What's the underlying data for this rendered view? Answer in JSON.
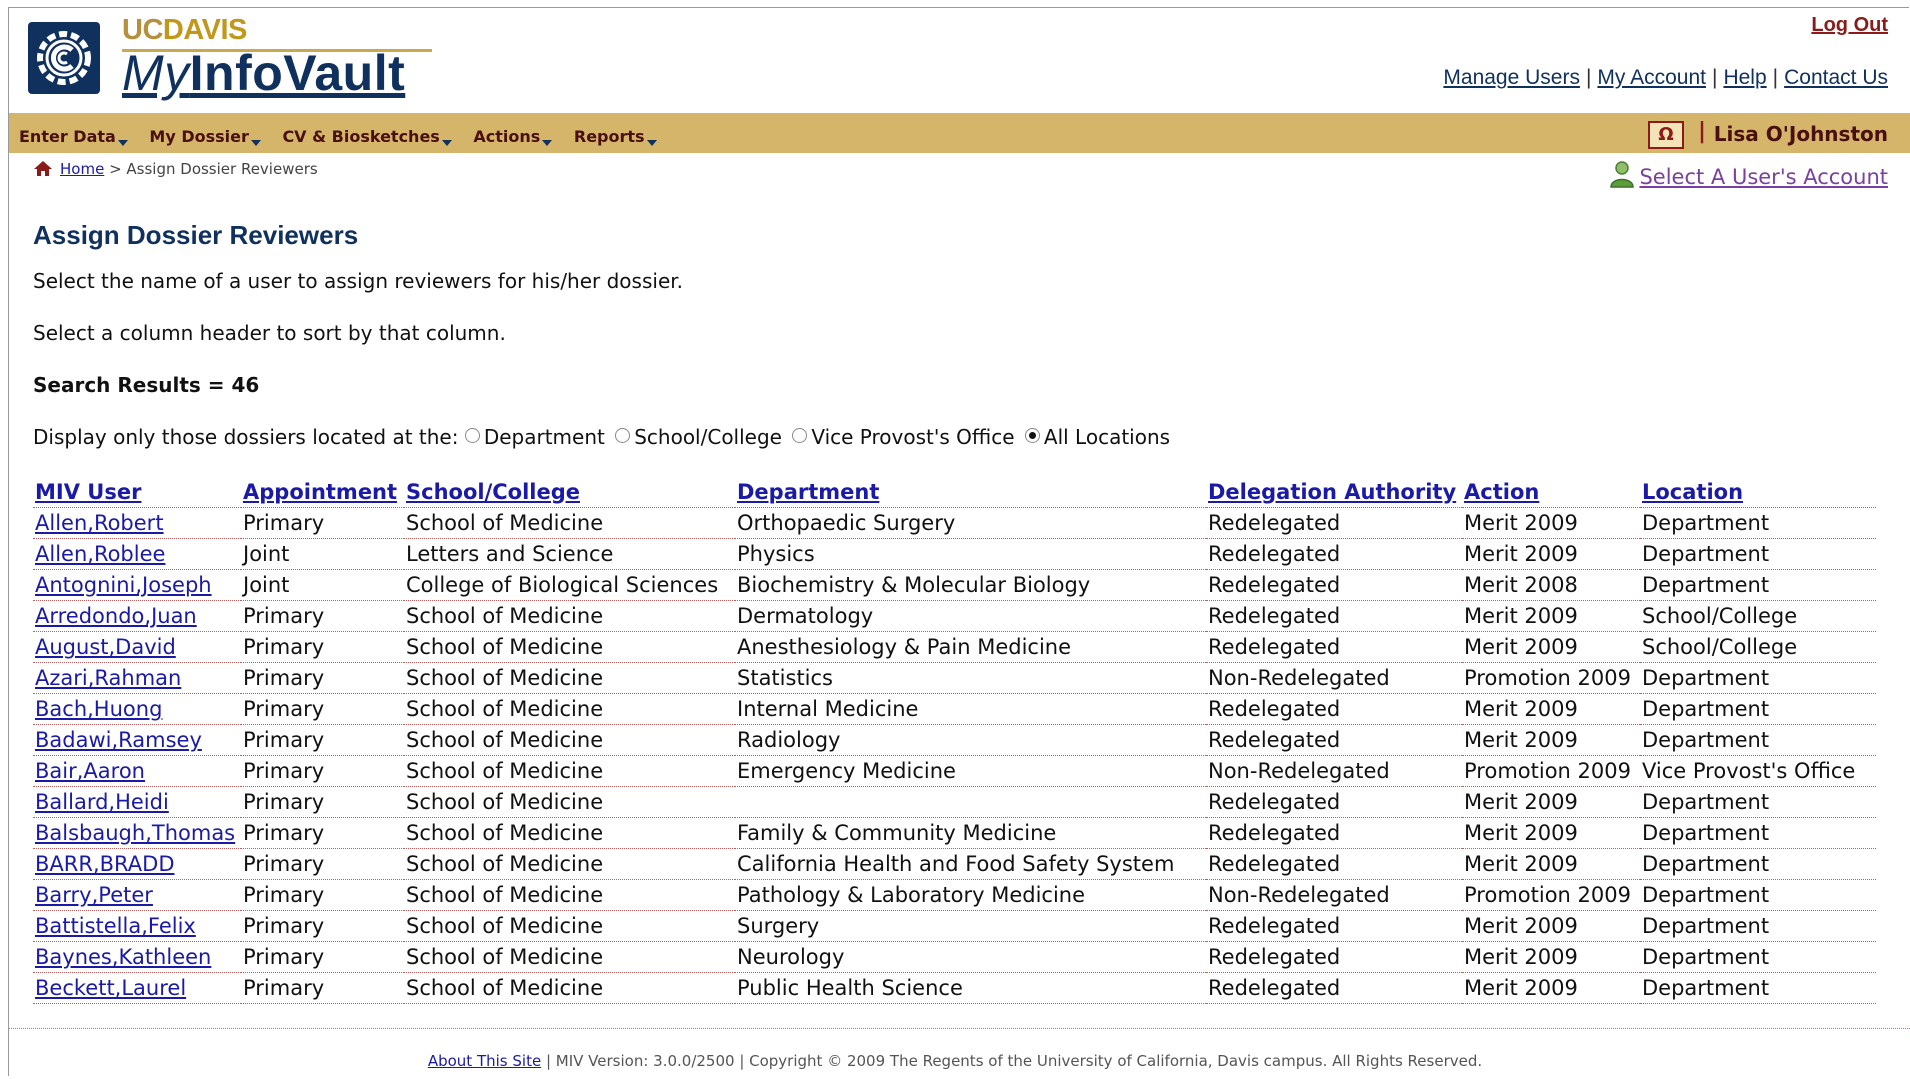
{
  "header": {
    "brand_uc": "UC",
    "brand_davis": "DAVIS",
    "brand_my": "My",
    "brand_infovault": "InfoVault",
    "logout": "Log Out",
    "links": [
      "Manage Users",
      "My Account",
      "Help",
      "Contact Us"
    ],
    "separator": "|"
  },
  "nav": {
    "items": [
      "Enter Data",
      "My Dossier",
      "CV & Biosketches",
      "Actions",
      "Reports"
    ],
    "omega": "Ω",
    "separator": "|",
    "user_name": "Lisa O'Johnston"
  },
  "breadcrumb": {
    "home": "Home",
    "current": "> Assign Dossier Reviewers"
  },
  "select_account": "Select A User's Account",
  "page": {
    "title": "Assign Dossier Reviewers",
    "instruction1": "Select the name of a user to assign reviewers for his/her dossier.",
    "instruction2": "Select a column header to sort by that column.",
    "results": "Search Results = 46",
    "filter_label": "Display only those dossiers located at the:",
    "filter_options": [
      "Department",
      "School/College",
      "Vice Provost's Office",
      "All Locations"
    ],
    "filter_selected": "All Locations"
  },
  "table": {
    "columns": [
      "MIV User",
      "Appointment",
      "School/College",
      "Department",
      "Delegation Authority",
      "Action",
      "Location"
    ],
    "rows": [
      [
        "Allen,Robert",
        "Primary",
        "School of Medicine",
        "Orthopaedic Surgery",
        "Redelegated",
        "Merit 2009",
        "Department"
      ],
      [
        "Allen,Roblee",
        "Joint",
        "Letters and Science",
        "Physics",
        "Redelegated",
        "Merit 2009",
        "Department"
      ],
      [
        "Antognini,Joseph",
        "Joint",
        "College of Biological Sciences",
        "Biochemistry & Molecular Biology",
        "Redelegated",
        "Merit 2008",
        "Department"
      ],
      [
        "Arredondo,Juan",
        "Primary",
        "School of Medicine",
        "Dermatology",
        "Redelegated",
        "Merit 2009",
        "School/College"
      ],
      [
        "August,David",
        "Primary",
        "School of Medicine",
        "Anesthesiology & Pain Medicine",
        "Redelegated",
        "Merit 2009",
        "School/College"
      ],
      [
        "Azari,Rahman",
        "Primary",
        "School of Medicine",
        "Statistics",
        "Non-Redelegated",
        "Promotion 2009",
        "Department"
      ],
      [
        "Bach,Huong",
        "Primary",
        "School of Medicine",
        "Internal Medicine",
        "Redelegated",
        "Merit 2009",
        "Department"
      ],
      [
        "Badawi,Ramsey",
        "Primary",
        "School of Medicine",
        "Radiology",
        "Redelegated",
        "Merit 2009",
        "Department"
      ],
      [
        "Bair,Aaron",
        "Primary",
        "School of Medicine",
        "Emergency Medicine",
        "Non-Redelegated",
        "Promotion 2009",
        "Vice Provost's Office"
      ],
      [
        "Ballard,Heidi",
        "Primary",
        "School of Medicine",
        "",
        "Redelegated",
        "Merit 2009",
        "Department"
      ],
      [
        "Balsbaugh,Thomas",
        "Primary",
        "School of Medicine",
        "Family & Community Medicine",
        "Redelegated",
        "Merit 2009",
        "Department"
      ],
      [
        "BARR,BRADD",
        "Primary",
        "School of Medicine",
        "California Health and Food Safety System",
        "Redelegated",
        "Merit 2009",
        "Department"
      ],
      [
        "Barry,Peter",
        "Primary",
        "School of Medicine",
        "Pathology & Laboratory Medicine",
        "Non-Redelegated",
        "Promotion 2009",
        "Department"
      ],
      [
        "Battistella,Felix",
        "Primary",
        "School of Medicine",
        "Surgery",
        "Redelegated",
        "Merit 2009",
        "Department"
      ],
      [
        "Baynes,Kathleen",
        "Primary",
        "School of Medicine",
        "Neurology",
        "Redelegated",
        "Merit 2009",
        "Department"
      ],
      [
        "Beckett,Laurel",
        "Primary",
        "School of Medicine",
        "Public Health Science",
        "Redelegated",
        "Merit 2009",
        "Department"
      ]
    ]
  },
  "footer": {
    "about": "About This Site",
    "text": " | MIV Version: 3.0.0/2500 | Copyright © 2009 The Regents of the University of California, Davis campus. All Rights Reserved."
  },
  "colors": {
    "navbar": "#d4b56a",
    "brand_navy": "#10305e",
    "brand_gold": "#c2981c",
    "link": "#1a1aa6",
    "logout": "#8b1a1a"
  },
  "icons": [
    "uc-davis-logo-icon",
    "dropdown-arrow-icon",
    "home-icon",
    "user-account-icon",
    "radio-button-icon"
  ]
}
